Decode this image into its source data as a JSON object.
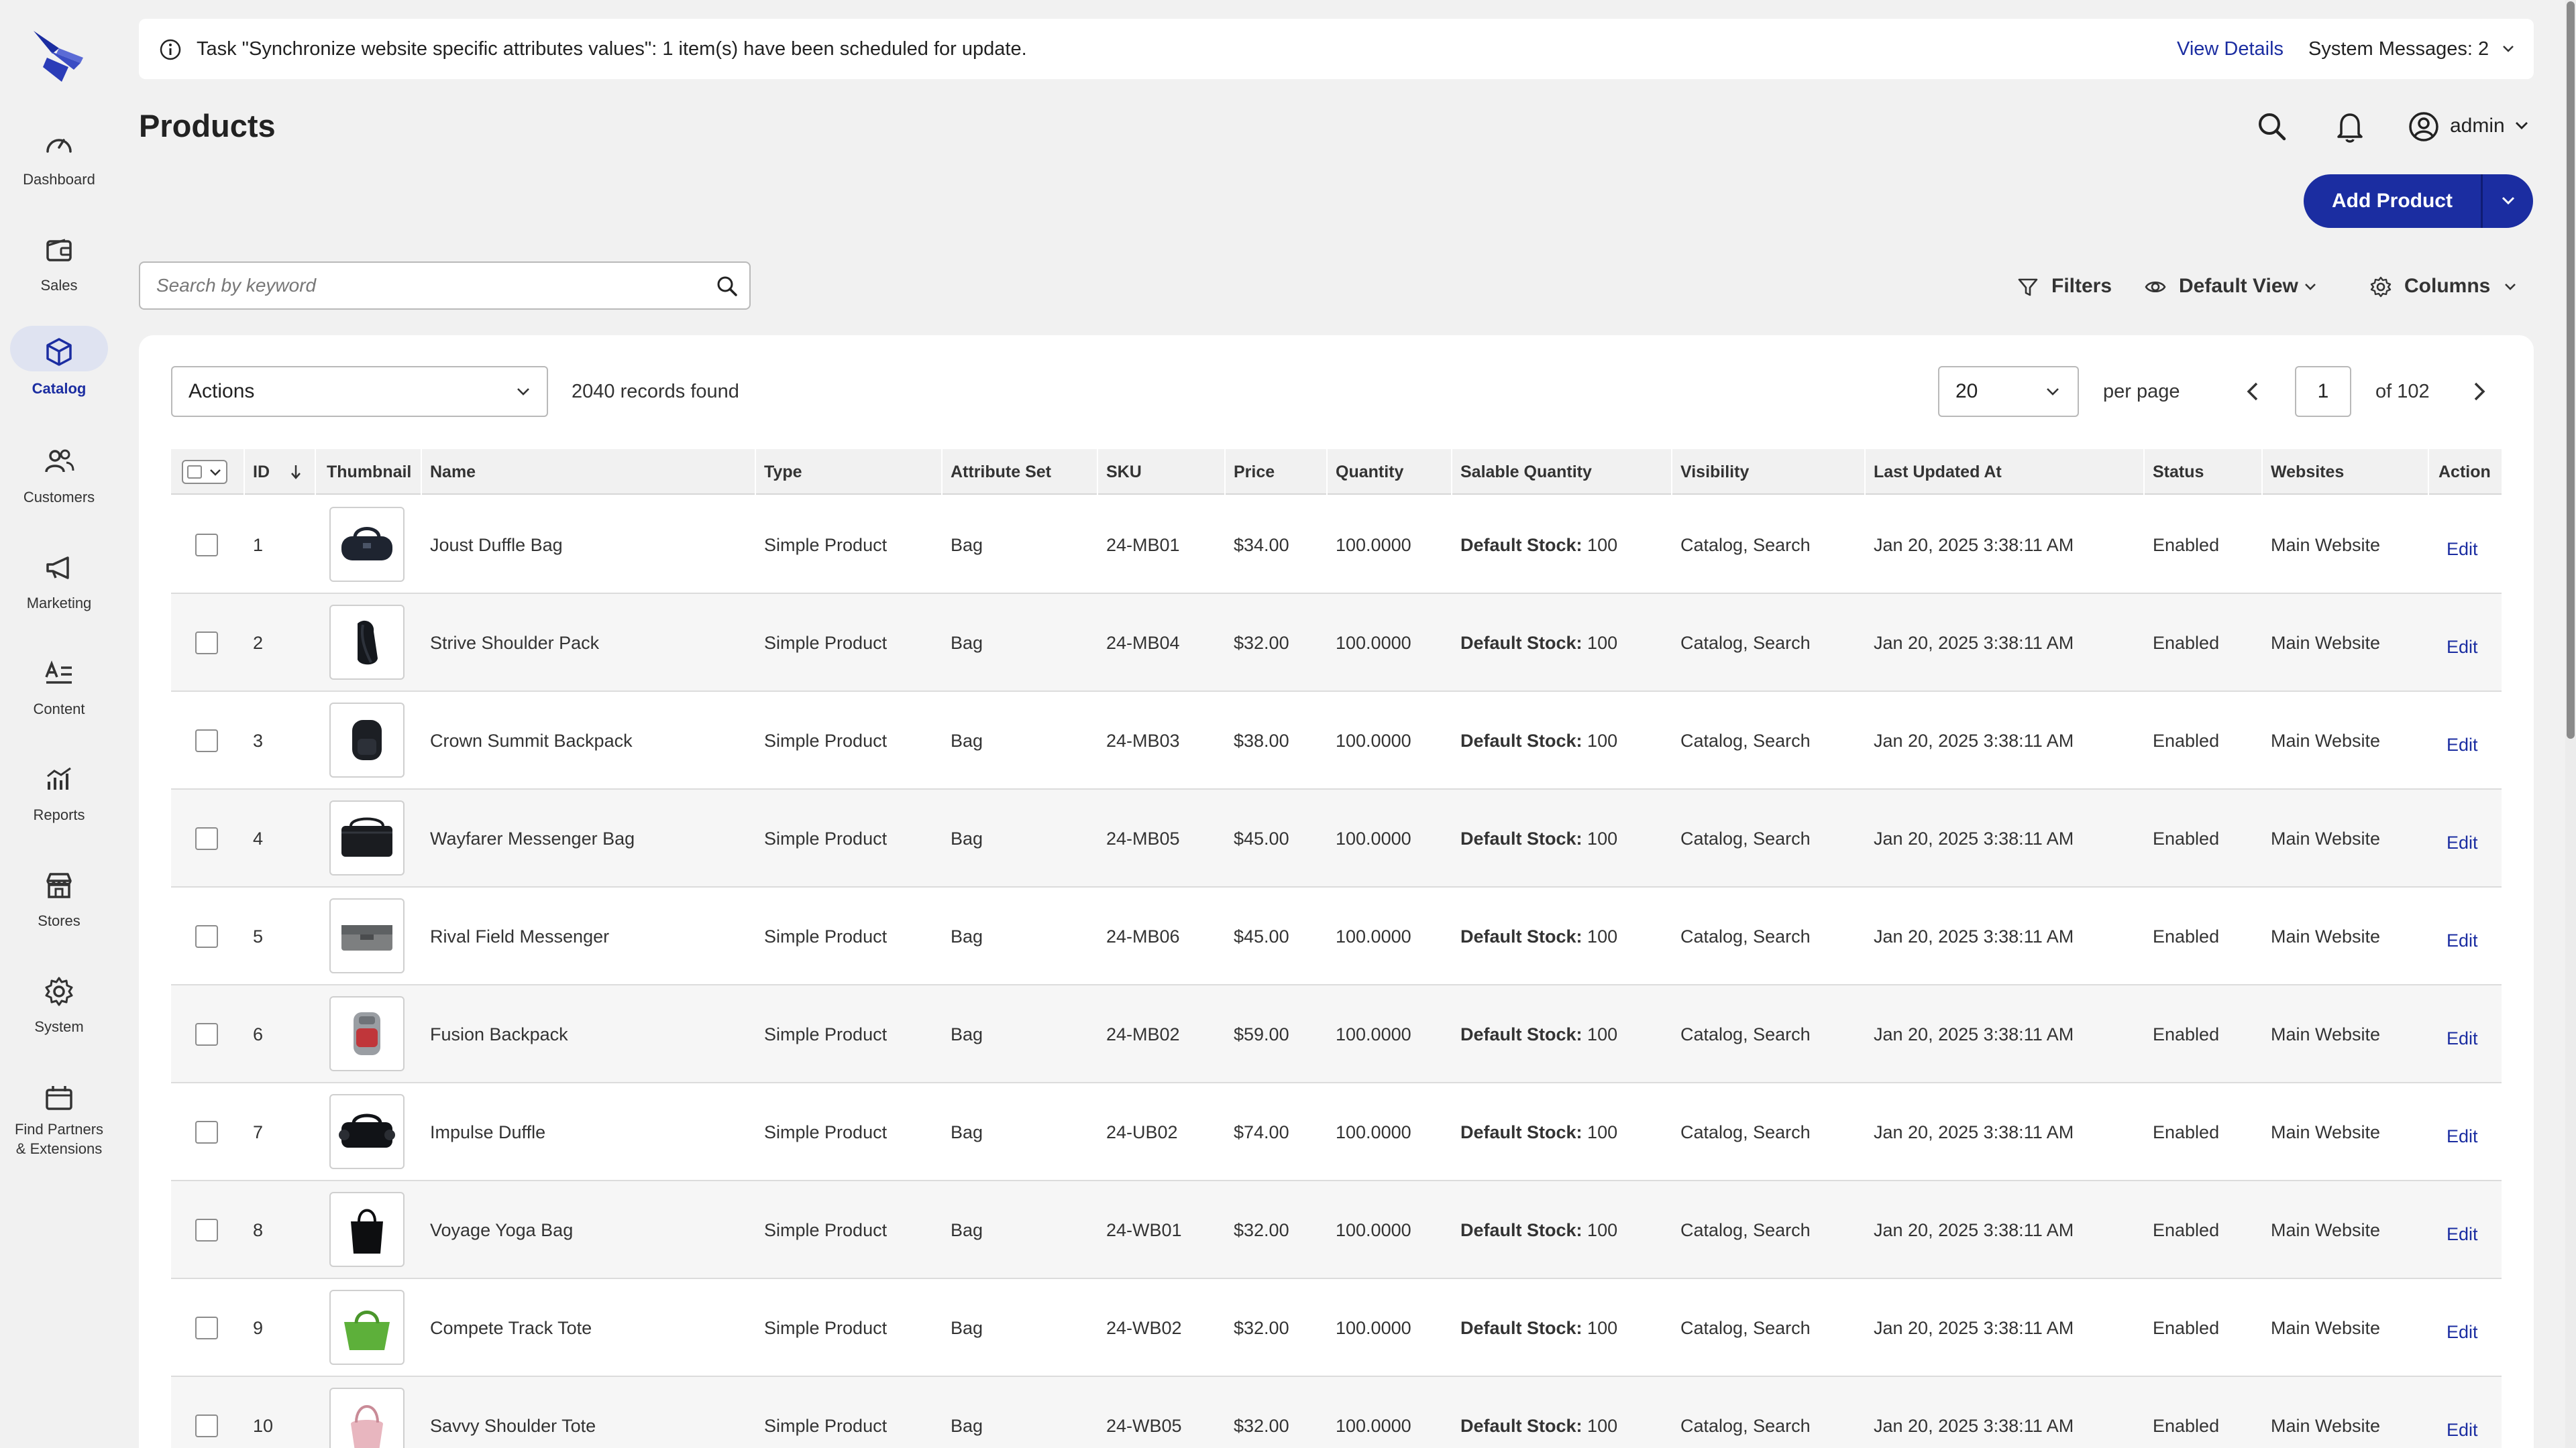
{
  "sidebar": {
    "items": [
      {
        "label": "Dashboard",
        "icon": "dashboard-gauge-icon"
      },
      {
        "label": "Sales",
        "icon": "wallet-icon"
      },
      {
        "label": "Catalog",
        "icon": "box-icon"
      },
      {
        "label": "Customers",
        "icon": "people-icon"
      },
      {
        "label": "Marketing",
        "icon": "megaphone-icon"
      },
      {
        "label": "Content",
        "icon": "text-content-icon"
      },
      {
        "label": "Reports",
        "icon": "bar-chart-icon"
      },
      {
        "label": "Stores",
        "icon": "storefront-icon"
      },
      {
        "label": "System",
        "icon": "gear-icon"
      },
      {
        "label_line1": "Find Partners",
        "label_line2": "& Extensions",
        "icon": "marketplace-icon"
      }
    ],
    "active": "Catalog"
  },
  "message_bar": {
    "text": "Task \"Synchronize website specific attributes values\": 1 item(s) have been scheduled for update.",
    "link": "View Details",
    "system_messages": "System Messages: 2"
  },
  "header": {
    "title": "Products",
    "user": "admin",
    "add_button": "Add Product"
  },
  "toolbar": {
    "search_placeholder": "Search by keyword",
    "filters": "Filters",
    "view": "Default View",
    "columns": "Columns"
  },
  "grid": {
    "actions": "Actions",
    "records": "2040 records found",
    "per_page_value": "20",
    "per_page_label": "per page",
    "page": "1",
    "page_total": "of 102",
    "columns": [
      "ID",
      "Thumbnail",
      "Name",
      "Type",
      "Attribute Set",
      "SKU",
      "Price",
      "Quantity",
      "Salable Quantity",
      "Visibility",
      "Last Updated At",
      "Status",
      "Websites",
      "Action"
    ],
    "rows": [
      {
        "id": "1",
        "name": "Joust Duffle Bag",
        "type": "Simple Product",
        "attr": "Bag",
        "sku": "24-MB01",
        "price": "$34.00",
        "qty": "100.0000",
        "sq_label": "Default Stock:",
        "sq_value": "100",
        "vis": "Catalog, Search",
        "updated": "Jan 20, 2025 3:38:11 AM",
        "status": "Enabled",
        "web": "Main Website",
        "action": "Edit"
      },
      {
        "id": "2",
        "name": "Strive Shoulder Pack",
        "type": "Simple Product",
        "attr": "Bag",
        "sku": "24-MB04",
        "price": "$32.00",
        "qty": "100.0000",
        "sq_label": "Default Stock:",
        "sq_value": "100",
        "vis": "Catalog, Search",
        "updated": "Jan 20, 2025 3:38:11 AM",
        "status": "Enabled",
        "web": "Main Website",
        "action": "Edit"
      },
      {
        "id": "3",
        "name": "Crown Summit Backpack",
        "type": "Simple Product",
        "attr": "Bag",
        "sku": "24-MB03",
        "price": "$38.00",
        "qty": "100.0000",
        "sq_label": "Default Stock:",
        "sq_value": "100",
        "vis": "Catalog, Search",
        "updated": "Jan 20, 2025 3:38:11 AM",
        "status": "Enabled",
        "web": "Main Website",
        "action": "Edit"
      },
      {
        "id": "4",
        "name": "Wayfarer Messenger Bag",
        "type": "Simple Product",
        "attr": "Bag",
        "sku": "24-MB05",
        "price": "$45.00",
        "qty": "100.0000",
        "sq_label": "Default Stock:",
        "sq_value": "100",
        "vis": "Catalog, Search",
        "updated": "Jan 20, 2025 3:38:11 AM",
        "status": "Enabled",
        "web": "Main Website",
        "action": "Edit"
      },
      {
        "id": "5",
        "name": "Rival Field Messenger",
        "type": "Simple Product",
        "attr": "Bag",
        "sku": "24-MB06",
        "price": "$45.00",
        "qty": "100.0000",
        "sq_label": "Default Stock:",
        "sq_value": "100",
        "vis": "Catalog, Search",
        "updated": "Jan 20, 2025 3:38:11 AM",
        "status": "Enabled",
        "web": "Main Website",
        "action": "Edit"
      },
      {
        "id": "6",
        "name": "Fusion Backpack",
        "type": "Simple Product",
        "attr": "Bag",
        "sku": "24-MB02",
        "price": "$59.00",
        "qty": "100.0000",
        "sq_label": "Default Stock:",
        "sq_value": "100",
        "vis": "Catalog, Search",
        "updated": "Jan 20, 2025 3:38:11 AM",
        "status": "Enabled",
        "web": "Main Website",
        "action": "Edit"
      },
      {
        "id": "7",
        "name": "Impulse Duffle",
        "type": "Simple Product",
        "attr": "Bag",
        "sku": "24-UB02",
        "price": "$74.00",
        "qty": "100.0000",
        "sq_label": "Default Stock:",
        "sq_value": "100",
        "vis": "Catalog, Search",
        "updated": "Jan 20, 2025 3:38:11 AM",
        "status": "Enabled",
        "web": "Main Website",
        "action": "Edit"
      },
      {
        "id": "8",
        "name": "Voyage Yoga Bag",
        "type": "Simple Product",
        "attr": "Bag",
        "sku": "24-WB01",
        "price": "$32.00",
        "qty": "100.0000",
        "sq_label": "Default Stock:",
        "sq_value": "100",
        "vis": "Catalog, Search",
        "updated": "Jan 20, 2025 3:38:11 AM",
        "status": "Enabled",
        "web": "Main Website",
        "action": "Edit"
      },
      {
        "id": "9",
        "name": "Compete Track Tote",
        "type": "Simple Product",
        "attr": "Bag",
        "sku": "24-WB02",
        "price": "$32.00",
        "qty": "100.0000",
        "sq_label": "Default Stock:",
        "sq_value": "100",
        "vis": "Catalog, Search",
        "updated": "Jan 20, 2025 3:38:11 AM",
        "status": "Enabled",
        "web": "Main Website",
        "action": "Edit"
      },
      {
        "id": "10",
        "name": "Savvy Shoulder Tote",
        "type": "Simple Product",
        "attr": "Bag",
        "sku": "24-WB05",
        "price": "$32.00",
        "qty": "100.0000",
        "sq_label": "Default Stock:",
        "sq_value": "100",
        "vis": "Catalog, Search",
        "updated": "Jan 20, 2025 3:38:11 AM",
        "status": "Enabled",
        "web": "Main Website",
        "action": "Edit"
      }
    ]
  },
  "colors": {
    "accent": "#1b2da1",
    "background": "#f1f1f1",
    "active_nav": "#dfe3f1"
  }
}
